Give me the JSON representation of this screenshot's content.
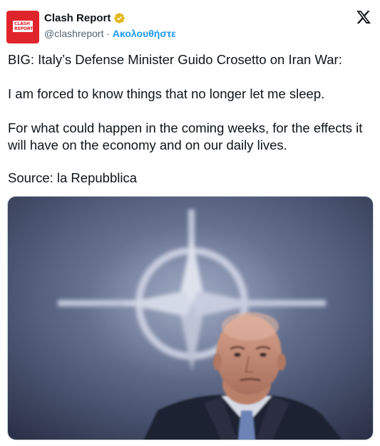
{
  "account": {
    "display_name": "Clash Report",
    "handle": "@clashreport",
    "separator": " · ",
    "follow_label": "Ακολουθήστε",
    "avatar_text_line1": "CLASH",
    "avatar_text_line2": "REPORT"
  },
  "tweet": {
    "paragraphs": [
      "BIG: Italy’s Defense Minister Guido Crosetto on Iran War:",
      "I am forced to know things that no longer let me sleep.",
      "For what could happen in the coming weeks, for the effects it will have on the economy and on our daily lives.",
      "Source: la Repubblica"
    ]
  },
  "colors": {
    "accent": "#1d9bf0",
    "avatar_red": "#e0242b",
    "verified_gold": "#e2b719",
    "text": "#0f1419",
    "secondary_text": "#536471"
  },
  "icons": {
    "verified": "verified-badge-icon",
    "platform": "x-logo-icon"
  }
}
